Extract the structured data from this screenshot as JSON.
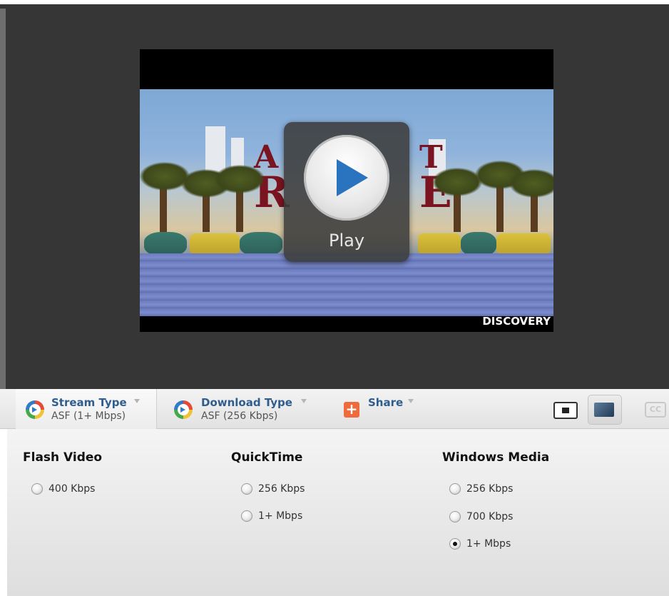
{
  "player": {
    "play_label": "Play",
    "channel_logo": "DISCOVERY"
  },
  "toolbar": {
    "stream": {
      "title": "Stream Type",
      "value": "ASF (1+ Mbps)"
    },
    "download": {
      "title": "Download Type",
      "value": "ASF (256 Kbps)"
    },
    "share": {
      "title": "Share"
    },
    "cc_label": "CC"
  },
  "formats": {
    "flash": {
      "heading": "Flash Video",
      "options": [
        "400 Kbps"
      ]
    },
    "quicktime": {
      "heading": "QuickTime",
      "options": [
        "256 Kbps",
        "1+ Mbps"
      ]
    },
    "windows": {
      "heading": "Windows Media",
      "options": [
        "256 Kbps",
        "700 Kbps",
        "1+ Mbps"
      ],
      "selected": "1+ Mbps"
    }
  },
  "colors": {
    "tab_title": "#2f5d8e",
    "share_icon": "#ef6a3c",
    "play_icon": "#2a73bf"
  },
  "icons": [
    "stream-type-icon",
    "download-type-icon",
    "share-plus-icon",
    "fit-screen-icon",
    "widescreen-icon",
    "closed-caption-icon",
    "play-icon",
    "dropdown-arrow-icon"
  ]
}
